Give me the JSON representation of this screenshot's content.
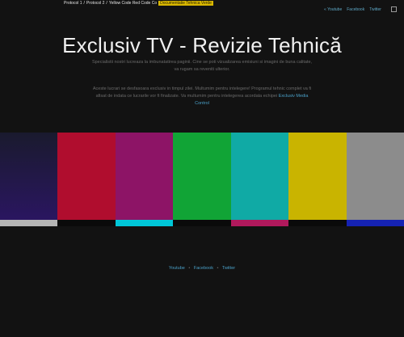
{
  "breadcrumbs": {
    "item1": "Protocol 1",
    "sep1": "/",
    "item2": "Protocol 2",
    "sep2": "/",
    "item3": "Yellow Code Red Code Co",
    "highlight": "Documentatie Tehnica Verde"
  },
  "nav": {
    "youtube": "« Youtube",
    "facebook": "Facebook",
    "twitter": "Twitter"
  },
  "header": {
    "title": "Exclusiv TV - Revizie Tehnică"
  },
  "intro": {
    "p1": "Specialistii nostri lucreaza la imbunatatirea paginii. Cine se poti vizualizarea emisiuni si imagini de buna calitate, va rugam sa reveniti ulterior.",
    "p2": "Aceste lucrari se desfasoara exclusiv in timpul zilei. Multumim pentru intelegere! Programul tehnic complet va fi afisat de indata ce lucrarile vor fi finalizate. Va multumim pentru intelegerea acordata echipei",
    "link": "Exclusiv Media Control"
  },
  "test_pattern": {
    "bars": [
      "#1a1a2e",
      "#2a1660",
      "#b00d2e",
      "#8d1466",
      "#11a436",
      "#10aaa5",
      "#c9b400",
      "#8c8c8c"
    ],
    "strips": [
      "#b5b5b5",
      "#0a0a0a",
      "#00c6d8",
      "#0a0a0a",
      "#b0195c",
      "#0a0a0a",
      "#1522b3"
    ]
  },
  "footer": {
    "youtube": "Youtube",
    "sep": "•",
    "facebook": "Facebook",
    "twitter": "Twitter"
  }
}
